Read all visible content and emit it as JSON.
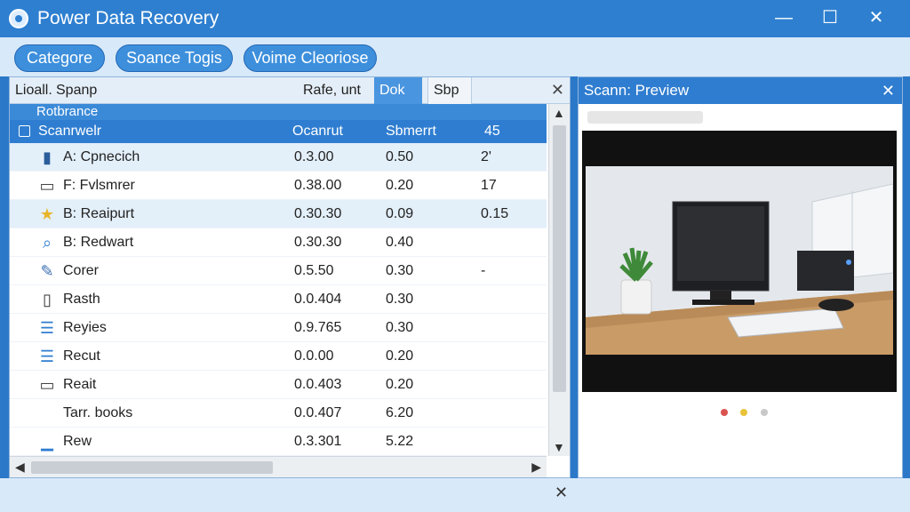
{
  "window": {
    "title": "Power Data Recovery",
    "minimize": "—",
    "maximize": "☐",
    "close": "✕"
  },
  "toolbar": {
    "buttons": [
      "Categore",
      "Soance Togis",
      "Voime Cleoriose"
    ]
  },
  "left_panel": {
    "tabs": [
      "Lioall.",
      "Spanp",
      "Rafe, unt",
      "Dok",
      "Sbp"
    ],
    "close": "✕",
    "header1": "Rotbrance",
    "columns": [
      "Scanrwelr",
      "Ocanrut",
      "Sbmerrt",
      "45"
    ],
    "rows": [
      {
        "icon": "drive-icon",
        "glyph": "▮",
        "name": "A: Cpnecich",
        "c1": "0.3.00",
        "c2": "0.50",
        "c3": "2'"
      },
      {
        "icon": "monitor-icon",
        "glyph": "▭",
        "name": "F: Fvlsmrer",
        "c1": "0.38.00",
        "c2": "0.20",
        "c3": "17"
      },
      {
        "icon": "star-icon",
        "glyph": "★",
        "name": "B: Reaipurt",
        "c1": "0.30.30",
        "c2": "0.09",
        "c3": "0.15"
      },
      {
        "icon": "search-icon",
        "glyph": "⌕",
        "name": "B: Redwart",
        "c1": "0.30.30",
        "c2": "0.40",
        "c3": ""
      },
      {
        "icon": "wrench-icon",
        "glyph": "✎",
        "name": "Corer",
        "c1": "0.5.50",
        "c2": "0.30",
        "c3": "-"
      },
      {
        "icon": "phone-icon",
        "glyph": "▯",
        "name": "Rasth",
        "c1": "0.0.404",
        "c2": "0.30",
        "c3": ""
      },
      {
        "icon": "document-icon",
        "glyph": "☰",
        "name": "Reyies",
        "c1": "0.9.765",
        "c2": "0.30",
        "c3": ""
      },
      {
        "icon": "file-icon",
        "glyph": "☰",
        "name": "Recut",
        "c1": "0.0.00",
        "c2": "0.20",
        "c3": ""
      },
      {
        "icon": "window-icon",
        "glyph": "▭",
        "name": "Reait",
        "c1": "0.0.403",
        "c2": "0.20",
        "c3": ""
      },
      {
        "icon": "",
        "glyph": "",
        "name": "Tarr. books",
        "c1": "0.0.407",
        "c2": "6.20",
        "c3": ""
      },
      {
        "icon": "chart-icon",
        "glyph": "▁",
        "name": "Rew",
        "c1": "0.3.301",
        "c2": "5.22",
        "c3": ""
      }
    ]
  },
  "right_panel": {
    "title": "Scann: Preview",
    "close": "✕"
  },
  "status": {
    "close": "✕"
  },
  "colors": {
    "accent": "#2f7dd0",
    "dot_red": "#d9534f",
    "dot_yellow": "#e8c33a",
    "dot_gray": "#c8c8c8"
  }
}
